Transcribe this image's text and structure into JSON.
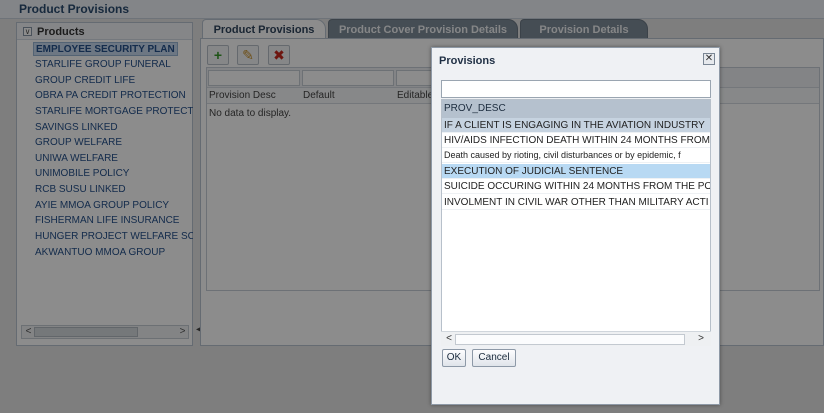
{
  "page": {
    "title": "Product Provisions"
  },
  "products": {
    "header": "Products",
    "toggle_glyph": "∨",
    "items": [
      "EMPLOYEE SECURITY PLAN",
      "STARLIFE GROUP FUNERAL",
      "GROUP CREDIT LIFE",
      "OBRA PA CREDIT PROTECTION",
      "STARLIFE MORTGAGE PROTECTI",
      "SAVINGS LINKED",
      "GROUP WELFARE",
      "UNIWA WELFARE",
      "UNIMOBILE POLICY",
      "RCB SUSU LINKED",
      "AYIE MMOA GROUP POLICY",
      "FISHERMAN LIFE INSURANCE",
      "HUNGER PROJECT WELFARE SCH",
      "AKWANTUO MMOA GROUP"
    ],
    "selected_index": 0,
    "scroll_left": "<",
    "scroll_right": ">"
  },
  "splitter_glyph": "◂",
  "tabs": [
    {
      "label": "Product Provisions",
      "active": true
    },
    {
      "label": "Product Cover Provision Details",
      "active": false
    },
    {
      "label": "Provision Details",
      "active": false
    }
  ],
  "toolbar": {
    "add_glyph": "+",
    "edit_glyph": "✎",
    "delete_glyph": "✖",
    "add_color": "#3a9a2a",
    "edit_color": "#c8902a",
    "delete_color": "#c8281e"
  },
  "grid": {
    "columns": [
      "Provision Desc",
      "Default",
      "Editable"
    ],
    "empty_text": "No data to display."
  },
  "dialog": {
    "title": "Provisions",
    "close_glyph": "✕",
    "search_value": "",
    "column_header": "PROV_DESC",
    "rows": [
      "IF A CLIENT IS ENGAGING IN THE AVIATION INDUSTRY",
      "HIV/AIDS INFECTION DEATH WITHIN 24 MONTHS FROM",
      "Death caused by rioting, civil disturbances or by epidemic, f",
      "EXECUTION OF JUDICIAL SENTENCE",
      "SUICIDE OCCURING WITHIN 24 MONTHS FROM THE PO",
      "INVOLMENT IN CIVIL WAR OTHER THAN MILITARY ACTI"
    ],
    "scroll_left": "<",
    "scroll_right": ">",
    "ok_label": "OK",
    "cancel_label": "Cancel"
  },
  "colors": {
    "brand_text": "#2a4b6f",
    "selection": "#c7d9ee",
    "row_highlight_gray": "#c6d3e0",
    "row_highlight_blue": "#b8d9f3"
  }
}
